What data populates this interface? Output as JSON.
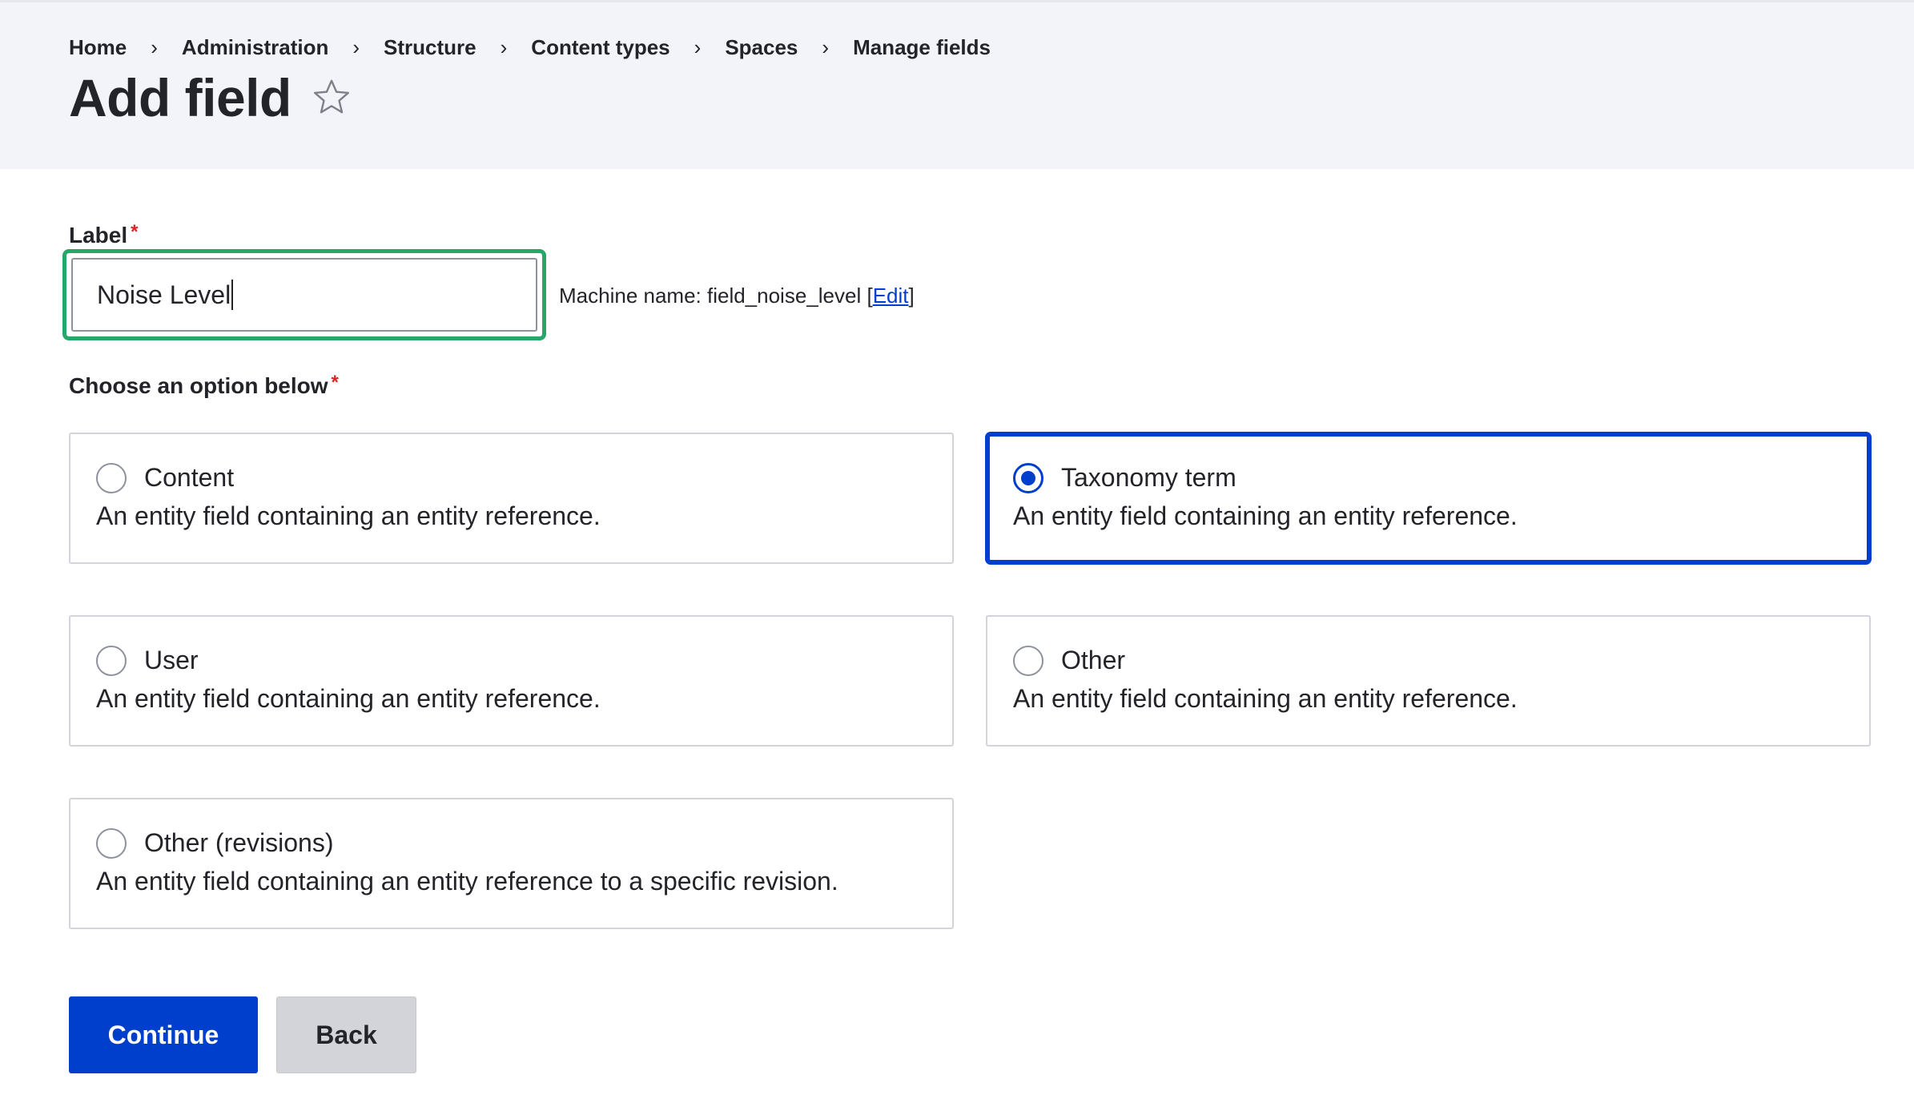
{
  "breadcrumb": {
    "items": [
      "Home",
      "Administration",
      "Structure",
      "Content types",
      "Spaces",
      "Manage fields"
    ],
    "separator": "›"
  },
  "page": {
    "title": "Add field",
    "favorite_icon": "star-outline-icon"
  },
  "label_field": {
    "label": "Label",
    "required_marker": "*",
    "value": "Noise Level",
    "machine_name_prefix": "Machine name: field_noise_level [",
    "machine_name_edit": "Edit",
    "machine_name_suffix": "]"
  },
  "options": {
    "label": "Choose an option below",
    "required_marker": "*",
    "selected": "Taxonomy term",
    "items": [
      {
        "title": "Content",
        "description": "An entity field containing an entity reference."
      },
      {
        "title": "Taxonomy term",
        "description": "An entity field containing an entity reference."
      },
      {
        "title": "User",
        "description": "An entity field containing an entity reference."
      },
      {
        "title": "Other",
        "description": "An entity field containing an entity reference."
      },
      {
        "title": "Other (revisions)",
        "description": "An entity field containing an entity reference to a specific revision."
      }
    ]
  },
  "actions": {
    "continue_label": "Continue",
    "back_label": "Back"
  },
  "colors": {
    "primary": "#003ecc",
    "focus_ring": "#26a769",
    "required": "#dc2323",
    "header_bg": "#f3f4f9"
  }
}
